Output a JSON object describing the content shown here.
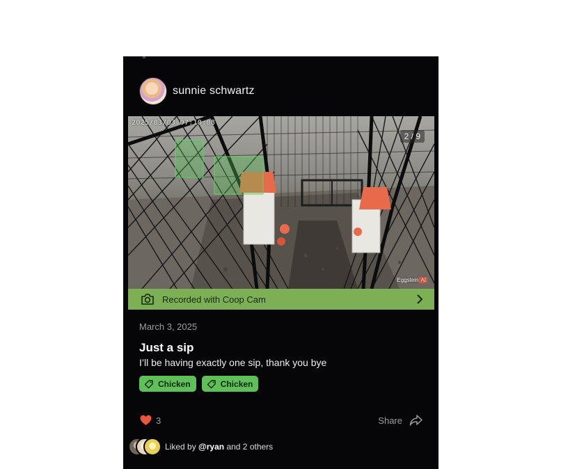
{
  "post": {
    "author": "sunnie schwartz",
    "media": {
      "timestamp": "2025/03/03 07:10:08",
      "counter": "2 / 9",
      "watermark": "Eggstein",
      "watermark_badge": "AI"
    },
    "recorded_with": "Recorded with Coop Cam",
    "date": "March 3, 2025",
    "title": "Just a sip",
    "caption": "I’ll be having exactly one sip, thank you bye",
    "tags": [
      "Chicken",
      "Chicken"
    ],
    "like_count": "3",
    "share_label": "Share",
    "liked_by": {
      "prefix": "Liked by",
      "user": "@ryan",
      "suffix": "and 2 others"
    }
  },
  "colors": {
    "background": "#060608",
    "coop_bar": "#7db055",
    "tag": "#5fc05a",
    "heart": "#e8573d",
    "feeder_cap": "#e86a4a"
  },
  "icons": {
    "camera": "camera-icon",
    "chevron": "chevron-right-icon",
    "tag": "tag-icon",
    "heart": "heart-icon",
    "share": "share-icon"
  }
}
